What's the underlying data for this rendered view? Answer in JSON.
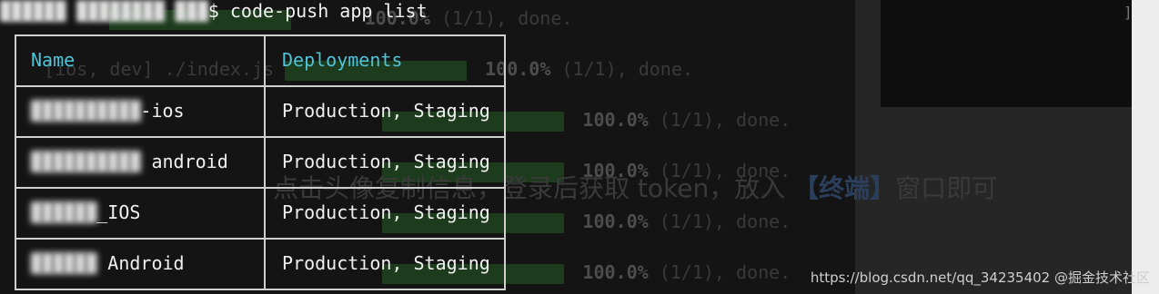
{
  "terminal": {
    "prompt_symbol": "$",
    "command": "code-push app list",
    "host_redacted": "██████ ████████ ███"
  },
  "table": {
    "headers": [
      "Name",
      "Deployments"
    ],
    "rows": [
      {
        "name_redacted": "██████████",
        "name_suffix": "-ios",
        "deployments": "Production, Staging"
      },
      {
        "name_redacted": "██████████",
        "name_suffix": " android",
        "deployments": "Production, Staging"
      },
      {
        "name_redacted": "██████",
        "name_suffix": "_IOS",
        "deployments": "Production, Staging"
      },
      {
        "name_redacted": "██████",
        "name_suffix": " Android",
        "deployments": "Production, Staging"
      }
    ]
  },
  "background": {
    "progress_text": "100.0%",
    "progress_count": "(1/1), done.",
    "file": "./index.js",
    "bracket_text": "[ios, dev]",
    "chinese_text_a": "点击头像复制信息，登录后获取 token，放入",
    "chinese_text_b": "【终端】",
    "chinese_text_c": "窗口即可",
    "watermark": "https://blog.csdn.net/qq_34235402 @掘金技术社区"
  }
}
